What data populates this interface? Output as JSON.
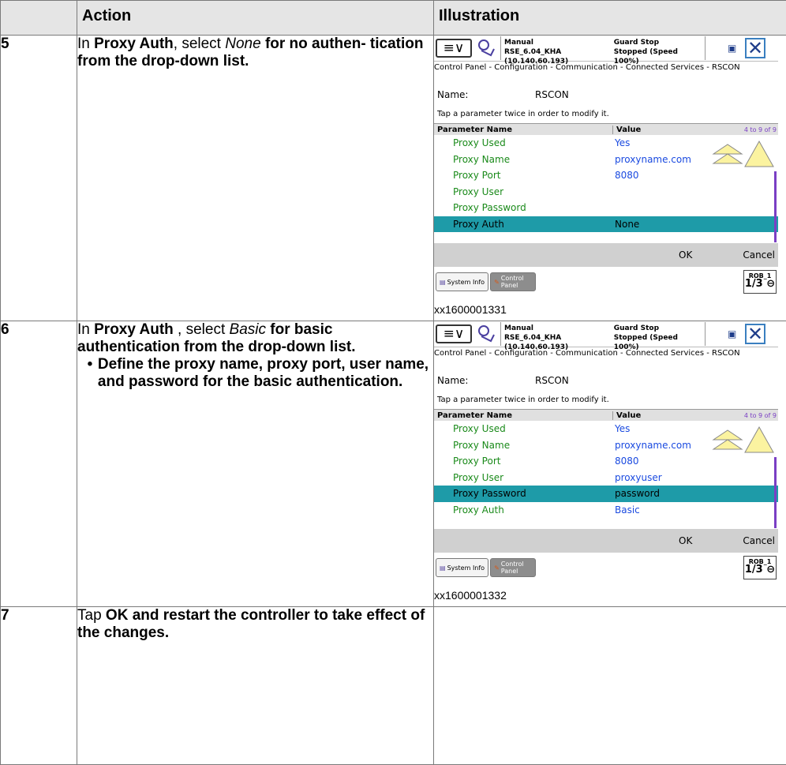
{
  "table": {
    "headers": {
      "num": "",
      "action": "Action",
      "illustration": "Illustration"
    },
    "rows": [
      {
        "num": "5",
        "action_parts": {
          "a": "In ",
          "b": "Proxy Auth",
          "c": ", select ",
          "d": "None",
          "e": " for no authen- tication from the drop-down list."
        },
        "caption": "xx1600001331",
        "screen": {
          "mode": "Manual",
          "system": "RSE_6.04_KHA (10.140.60.193)",
          "guard": "Guard Stop",
          "state": "Stopped (Speed 100%)",
          "breadcrumb": "Control Panel - Configuration - Communication - Connected Services - RSCON",
          "name_label": "Name:",
          "name_value": "RSCON",
          "hint": "Tap a parameter twice in order to modify it.",
          "col_name": "Parameter Name",
          "col_value": "Value",
          "range": "4 to 9 of 9",
          "params": [
            {
              "name": "Proxy Used",
              "value": "Yes"
            },
            {
              "name": "Proxy Name",
              "value": "proxyname.com"
            },
            {
              "name": "Proxy Port",
              "value": "8080"
            },
            {
              "name": "Proxy User",
              "value": ""
            },
            {
              "name": "Proxy Password",
              "value": ""
            },
            {
              "name": "Proxy Auth",
              "value": "None"
            }
          ],
          "selected_param": "Proxy Auth",
          "ok": "OK",
          "cancel": "Cancel",
          "taskbar_system": "System Info",
          "taskbar_control": "Control Panel",
          "rob": "ROB_1",
          "rob_fraction": "1/3"
        }
      },
      {
        "num": "6",
        "action_parts": {
          "a": "In ",
          "b": "Proxy Auth",
          "c": " , select ",
          "d": "Basic",
          "e": " for basic authentication from the drop-down list."
        },
        "bullet": "Define the proxy name, proxy port, user name, and password for the basic authentication.",
        "caption": "xx1600001332",
        "screen": {
          "mode": "Manual",
          "system": "RSE_6.04_KHA (10.140.60.193)",
          "guard": "Guard Stop",
          "state": "Stopped (Speed 100%)",
          "breadcrumb": "Control Panel - Configuration - Communication - Connected Services - RSCON",
          "name_label": "Name:",
          "name_value": "RSCON",
          "hint": "Tap a parameter twice in order to modify it.",
          "col_name": "Parameter Name",
          "col_value": "Value",
          "range": "4 to 9 of 9",
          "params": [
            {
              "name": "Proxy Used",
              "value": "Yes"
            },
            {
              "name": "Proxy Name",
              "value": "proxyname.com"
            },
            {
              "name": "Proxy Port",
              "value": "8080"
            },
            {
              "name": "Proxy User",
              "value": "proxyuser"
            },
            {
              "name": "Proxy Password",
              "value": "password"
            },
            {
              "name": "Proxy Auth",
              "value": "Basic"
            }
          ],
          "selected_param": "Proxy Password",
          "ok": "OK",
          "cancel": "Cancel",
          "taskbar_system": "System Info",
          "taskbar_control": "Control Panel",
          "rob": "ROB_1",
          "rob_fraction": "1/3"
        }
      },
      {
        "num": "7",
        "action_parts": {
          "a": "Tap ",
          "b": "OK",
          "c": " and restart the controller to take effect of the changes."
        }
      }
    ]
  }
}
